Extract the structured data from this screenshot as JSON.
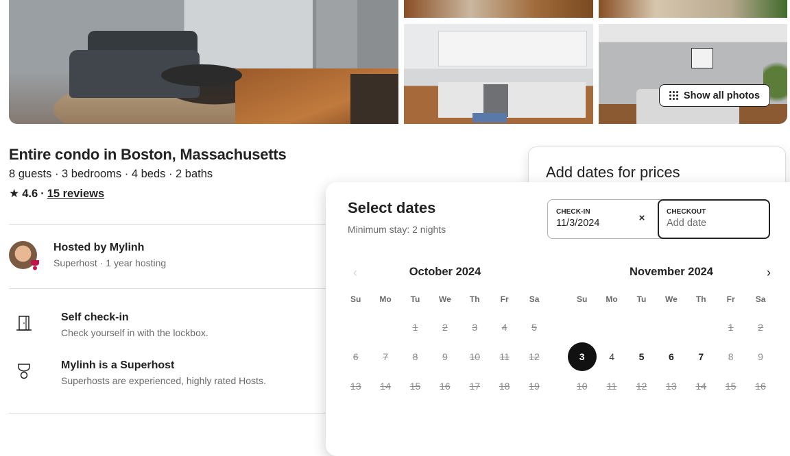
{
  "photos": {
    "show_all_label": "Show all photos",
    "items": [
      {
        "alt": "Living room with gray sofa and round coffee table"
      },
      {
        "alt": "Bedroom with patterned rug"
      },
      {
        "alt": "Living area with coffee table and plant"
      },
      {
        "alt": "White kitchen with stainless appliances"
      },
      {
        "alt": "Bedroom with white metal bed frame"
      }
    ]
  },
  "listing": {
    "title": "Entire condo in Boston, Massachusetts",
    "overview": "8 guests · 3 bedrooms · 4 beds · 2 baths",
    "rating": "4.6",
    "separator": "·",
    "reviews_label": "15 reviews"
  },
  "host": {
    "name_line": "Hosted by Mylinh",
    "sub_line": "Superhost · 1 year hosting"
  },
  "highlights": [
    {
      "icon": "door-icon",
      "title": "Self check-in",
      "subtitle": "Check yourself in with the lockbox."
    },
    {
      "icon": "superhost-medal-icon",
      "title": "Mylinh is a Superhost",
      "subtitle": "Superhosts are experienced, highly rated Hosts."
    }
  ],
  "booking": {
    "title": "Add dates for prices"
  },
  "datepicker": {
    "title": "Select dates",
    "subtitle": "Minimum stay: 2 nights",
    "checkin_label": "CHECK-IN",
    "checkin_value": "11/3/2024",
    "checkout_label": "CHECKOUT",
    "checkout_placeholder": "Add date",
    "clear_symbol": "×",
    "prev_symbol": "‹",
    "next_symbol": "›",
    "weekdays": [
      "Su",
      "Mo",
      "Tu",
      "We",
      "Th",
      "Fr",
      "Sa"
    ],
    "months": [
      {
        "title": "October 2024",
        "weeks": [
          [
            null,
            null,
            {
              "d": "1",
              "s": "past"
            },
            {
              "d": "2",
              "s": "past"
            },
            {
              "d": "3",
              "s": "past"
            },
            {
              "d": "4",
              "s": "past"
            },
            {
              "d": "5",
              "s": "past"
            }
          ],
          [
            {
              "d": "6",
              "s": "past"
            },
            {
              "d": "7",
              "s": "past"
            },
            {
              "d": "8",
              "s": "past"
            },
            {
              "d": "9",
              "s": "past"
            },
            {
              "d": "10",
              "s": "past"
            },
            {
              "d": "11",
              "s": "past"
            },
            {
              "d": "12",
              "s": "past"
            }
          ],
          [
            {
              "d": "13",
              "s": "past"
            },
            {
              "d": "14",
              "s": "past"
            },
            {
              "d": "15",
              "s": "past"
            },
            {
              "d": "16",
              "s": "past"
            },
            {
              "d": "17",
              "s": "past"
            },
            {
              "d": "18",
              "s": "past"
            },
            {
              "d": "19",
              "s": "past"
            }
          ]
        ]
      },
      {
        "title": "November 2024",
        "weeks": [
          [
            null,
            null,
            null,
            null,
            null,
            {
              "d": "1",
              "s": "past"
            },
            {
              "d": "2",
              "s": "past"
            }
          ],
          [
            {
              "d": "3",
              "s": "selected"
            },
            {
              "d": "4",
              "s": "mid"
            },
            {
              "d": "5",
              "s": "available"
            },
            {
              "d": "6",
              "s": "available"
            },
            {
              "d": "7",
              "s": "available"
            },
            {
              "d": "8",
              "s": "unavail"
            },
            {
              "d": "9",
              "s": "unavail"
            }
          ],
          [
            {
              "d": "10",
              "s": "past"
            },
            {
              "d": "11",
              "s": "past"
            },
            {
              "d": "12",
              "s": "past"
            },
            {
              "d": "13",
              "s": "past"
            },
            {
              "d": "14",
              "s": "past"
            },
            {
              "d": "15",
              "s": "past"
            },
            {
              "d": "16",
              "s": "past"
            }
          ]
        ]
      }
    ]
  },
  "colors": {
    "text_primary": "#222222",
    "text_secondary": "#6a6a6a",
    "selected_day_bg": "#111111",
    "superhost_badge": "#c1134a",
    "divider": "#dddddd"
  }
}
